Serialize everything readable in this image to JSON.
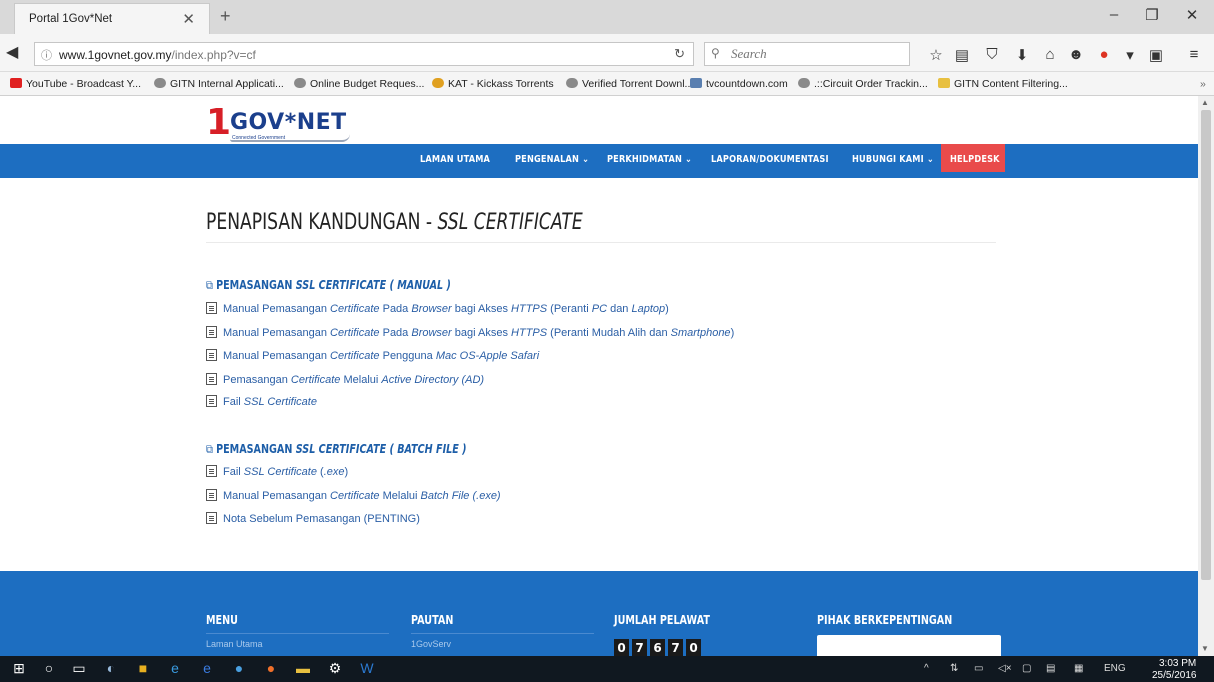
{
  "browser": {
    "tab_title": "Portal 1Gov*Net",
    "url_host": "www.1govnet.gov.my",
    "url_path": "/index.php?v=cf",
    "search_placeholder": "Search",
    "bookmarks": [
      {
        "label": "YouTube - Broadcast Y...",
        "color": "#e02020"
      },
      {
        "label": "GITN Internal Applicati...",
        "color": "#8a8a8a"
      },
      {
        "label": "Online Budget Reques...",
        "color": "#8a8a8a"
      },
      {
        "label": "KAT - Kickass Torrents",
        "color": "#e0a020"
      },
      {
        "label": "Verified Torrent Downl...",
        "color": "#8a8a8a"
      },
      {
        "label": "tvcountdown.com",
        "color": "#5a7fb0"
      },
      {
        "label": ".::Circuit Order Trackin...",
        "color": "#8a8a8a"
      },
      {
        "label": "GITN Content Filtering...",
        "color": "#e8c040"
      }
    ]
  },
  "site": {
    "logo_one": "1",
    "logo_text": "GOV*NET",
    "logo_sub": "Connected Government",
    "nav": [
      {
        "label": "LAMAN UTAMA"
      },
      {
        "label": "PENGENALAN ⌄"
      },
      {
        "label": "PERKHIDMATAN ⌄"
      },
      {
        "label": "LAPORAN/DOKUMENTASI"
      },
      {
        "label": "HUBUNGI KAMI ⌄"
      }
    ],
    "helpdesk": "HELPDESK"
  },
  "content": {
    "title_main": "PENAPISAN KANDUNGAN - ",
    "title_em": "SSL CERTIFICATE",
    "sections": [
      {
        "head_pre": "PEMASANGAN ",
        "head_em": "SSL CERTIFICATE ( MANUAL )",
        "links": [
          [
            {
              "t": "Manual Pemasangan "
            },
            {
              "t": "Certificate",
              "i": true
            },
            {
              "t": " Pada "
            },
            {
              "t": "Browser",
              "i": true
            },
            {
              "t": " bagi Akses "
            },
            {
              "t": "HTTPS",
              "i": true
            },
            {
              "t": " (Peranti "
            },
            {
              "t": "PC",
              "i": true
            },
            {
              "t": " dan "
            },
            {
              "t": "Laptop",
              "i": true
            },
            {
              "t": ")"
            }
          ],
          [
            {
              "t": "Manual Pemasangan "
            },
            {
              "t": "Certificate",
              "i": true
            },
            {
              "t": " Pada "
            },
            {
              "t": "Browser",
              "i": true
            },
            {
              "t": " bagi Akses "
            },
            {
              "t": "HTTPS",
              "i": true
            },
            {
              "t": " (Peranti Mudah Alih dan "
            },
            {
              "t": "Smartphone",
              "i": true
            },
            {
              "t": ")"
            }
          ],
          [
            {
              "t": "Manual Pemasangan "
            },
            {
              "t": "Certificate",
              "i": true
            },
            {
              "t": " Pengguna "
            },
            {
              "t": "Mac OS-Apple Safari",
              "i": true
            }
          ],
          [
            {
              "t": "Pemasangan "
            },
            {
              "t": "Certificate",
              "i": true
            },
            {
              "t": " Melalui "
            },
            {
              "t": "Active Directory (AD)",
              "i": true
            }
          ],
          [
            {
              "t": "Fail "
            },
            {
              "t": "SSL Certificate",
              "i": true
            }
          ]
        ]
      },
      {
        "head_pre": "PEMASANGAN ",
        "head_em": "SSL CERTIFICATE ( BATCH FILE )",
        "links": [
          [
            {
              "t": "Fail "
            },
            {
              "t": "SSL Certificate",
              "i": true
            },
            {
              "t": " ("
            },
            {
              "t": ".exe",
              "i": true
            },
            {
              "t": ")"
            }
          ],
          [
            {
              "t": "Manual Pemasangan "
            },
            {
              "t": "Certificate",
              "i": true
            },
            {
              "t": " Melalui "
            },
            {
              "t": "Batch File (.exe)",
              "i": true
            }
          ],
          [
            {
              "t": "Nota Sebelum Pemasangan (PENTING)"
            }
          ]
        ]
      }
    ]
  },
  "footer": {
    "menu_head": "MENU",
    "menu_first": "Laman Utama",
    "pautan_head": "PAUTAN",
    "pautan_first": "1GovServ",
    "pelawat_head": "JUMLAH PELAWAT",
    "counter_digits": [
      "0",
      "7",
      "6",
      "7",
      "0"
    ],
    "partner_head": "PIHAK BERKEPENTINGAN"
  },
  "taskbar": {
    "lang": "ENG",
    "time": "3:03 PM",
    "date": "25/5/2016"
  },
  "colors": {
    "nav_blue": "#1d6ec1",
    "helpdesk_red": "#e94b4b",
    "link_blue": "#2a5ea5",
    "logo_red": "#d71f27",
    "logo_blue": "#1b3f8c"
  }
}
